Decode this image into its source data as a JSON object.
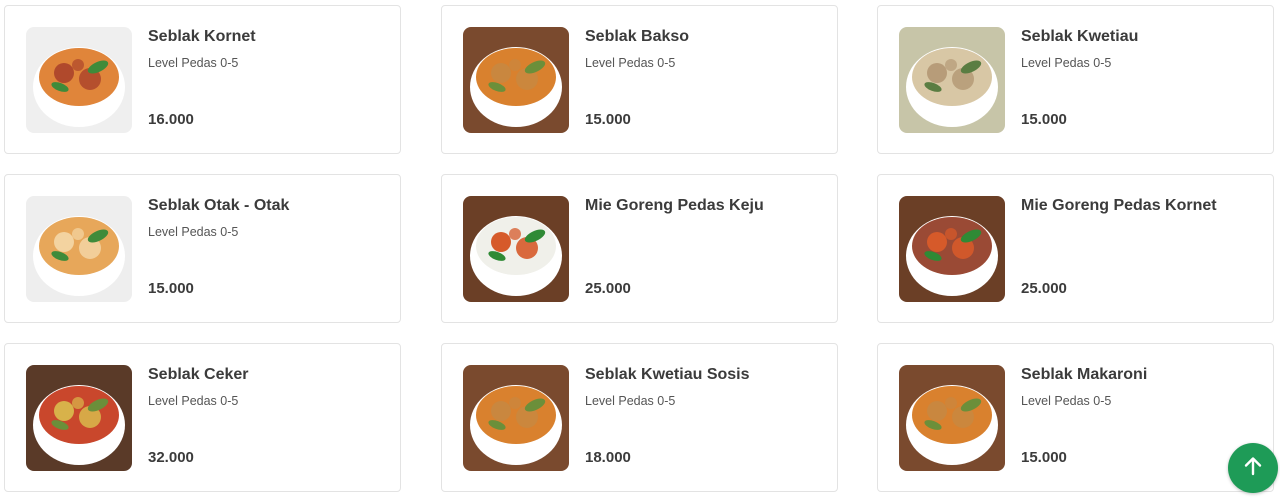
{
  "menu": {
    "items": [
      {
        "name": "Seblak Kornet",
        "description": "Level Pedas 0-5",
        "price": "16.000",
        "image_icon": "seblak-kornet-bowl-icon",
        "bg": "#efefef",
        "broth": "#e0853a",
        "topping": "#b0492c",
        "greens": "#3f8b3a"
      },
      {
        "name": "Seblak Bakso",
        "description": "Level Pedas 0-5",
        "price": "15.000",
        "image_icon": "seblak-bakso-bowl-icon",
        "bg": "#7a4a2e",
        "broth": "#d9812e",
        "topping": "#c9873f",
        "greens": "#6b8f3a"
      },
      {
        "name": "Seblak Kwetiau",
        "description": "Level Pedas 0-5",
        "price": "15.000",
        "image_icon": "seblak-kwetiau-bowl-icon",
        "bg": "#c7c5a8",
        "broth": "#d8c7a5",
        "topping": "#b79c79",
        "greens": "#5a7d42"
      },
      {
        "name": "Seblak Otak - Otak",
        "description": "Level Pedas 0-5",
        "price": "15.000",
        "image_icon": "seblak-otak-otak-bowl-icon",
        "bg": "#eeeeee",
        "broth": "#e7a75a",
        "topping": "#f3d3a0",
        "greens": "#3f8b3a"
      },
      {
        "name": "Mie Goreng Pedas Keju",
        "description": "",
        "price": "25.000",
        "image_icon": "mie-goreng-keju-bowl-icon",
        "bg": "#6b3f26",
        "broth": "#f0f0ea",
        "topping": "#d65a2a",
        "greens": "#2f8a35"
      },
      {
        "name": "Mie Goreng Pedas Kornet",
        "description": "",
        "price": "25.000",
        "image_icon": "mie-goreng-kornet-bowl-icon",
        "bg": "#6b3f26",
        "broth": "#9a4a35",
        "topping": "#d65a2a",
        "greens": "#2f8a35"
      },
      {
        "name": "Seblak Ceker",
        "description": "Level Pedas 0-5",
        "price": "32.000",
        "image_icon": "seblak-ceker-bowl-icon",
        "bg": "#5a3a28",
        "broth": "#c9472c",
        "topping": "#d8b24a",
        "greens": "#6b8f3a"
      },
      {
        "name": "Seblak Kwetiau Sosis",
        "description": "Level Pedas 0-5",
        "price": "18.000",
        "image_icon": "seblak-kwetiau-sosis-bowl-icon",
        "bg": "#7a4a2e",
        "broth": "#d9812e",
        "topping": "#c9873f",
        "greens": "#6b8f3a"
      },
      {
        "name": "Seblak Makaroni",
        "description": "Level Pedas 0-5",
        "price": "15.000",
        "image_icon": "seblak-makaroni-bowl-icon",
        "bg": "#7a4a2e",
        "broth": "#d9812e",
        "topping": "#c9873f",
        "greens": "#6b8f3a"
      }
    ]
  },
  "scroll_top": {
    "icon": "arrow-up-icon",
    "color": "#1e9b57"
  }
}
